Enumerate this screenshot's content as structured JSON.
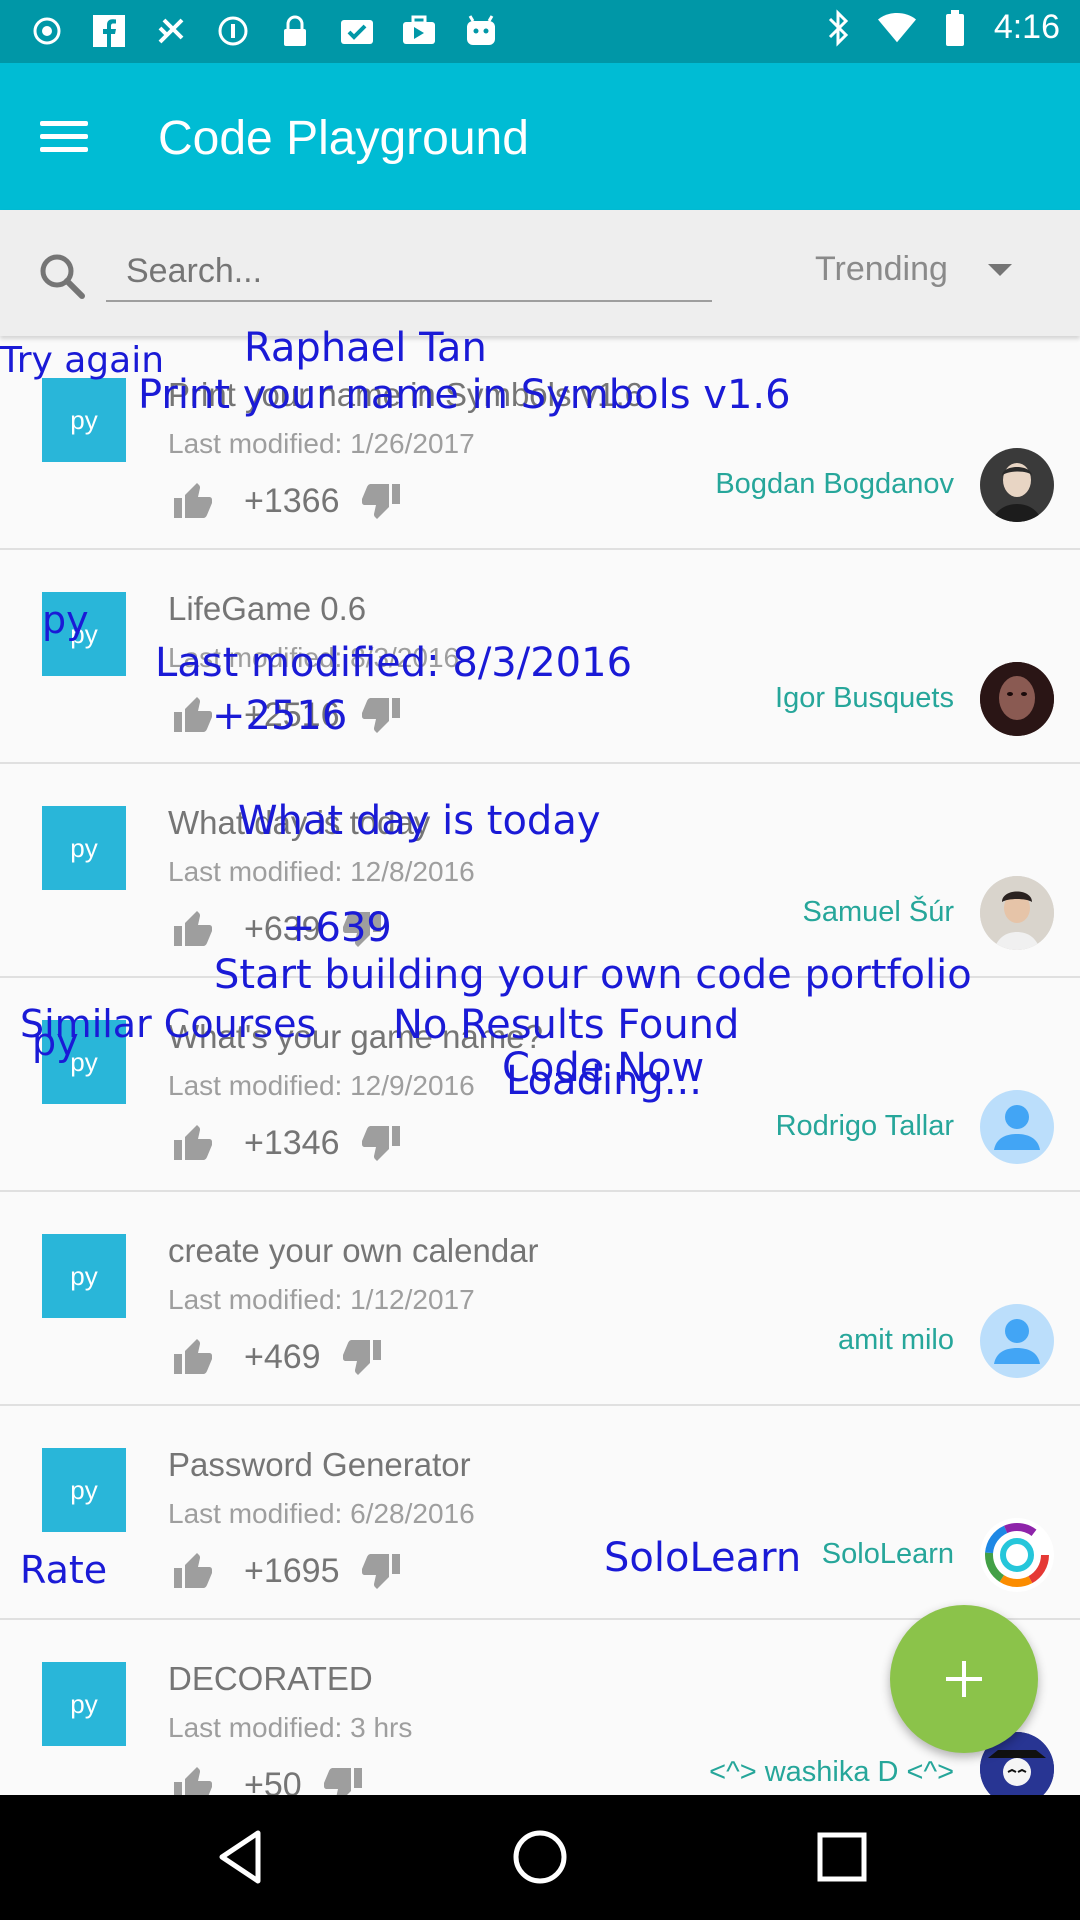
{
  "status_bar": {
    "time": "4:16",
    "left_icons": [
      "notification-dot-icon",
      "facebook-icon",
      "fake-gps-icon",
      "info-icon",
      "lock-icon",
      "checkbox-icon",
      "briefcase-icon",
      "play-store-icon",
      "android-icon"
    ],
    "right_icons": [
      "bluetooth-icon",
      "wifi-icon",
      "battery-icon"
    ]
  },
  "app_bar": {
    "title": "Code Playground",
    "menu_icon": "hamburger-menu-icon"
  },
  "search": {
    "placeholder": "Search...",
    "sort_selected": "Trending"
  },
  "rows": [
    {
      "lang": "py",
      "title": "Print your name in Symbols v1.6",
      "date": "Last modified: 1/26/2017",
      "votes": "+1366",
      "author": "Bogdan Bogdanov"
    },
    {
      "lang": "py",
      "title": "LifeGame 0.6",
      "date": "Last modified: 8/3/2016",
      "votes": "+2516",
      "author": "Igor Busquets"
    },
    {
      "lang": "py",
      "title": "What day is today",
      "date": "Last modified: 12/8/2016",
      "votes": "+639",
      "author": "Samuel Šúr"
    },
    {
      "lang": "py",
      "title": "What's your game name?",
      "date": "Last modified: 12/9/2016",
      "votes": "+1346",
      "author": "Rodrigo Tallar"
    },
    {
      "lang": "py",
      "title": "create your own calendar",
      "date": "Last modified: 1/12/2017",
      "votes": "+469",
      "author": "amit milo"
    },
    {
      "lang": "py",
      "title": "Password Generator",
      "date": "Last modified: 6/28/2016",
      "votes": "+1695",
      "author": "SoloLearn"
    },
    {
      "lang": "py",
      "title": "DECORATED",
      "date": "Last modified: 3 hrs",
      "votes": "+50",
      "author": "<^> washika D <^>"
    }
  ],
  "overlays": {
    "try_again": "Try again",
    "raphael": "Raphael Tan",
    "print_name": "Print your name in Symbols v1.6",
    "py_badge": "py",
    "last_modified": "Last modified: 8/3/2016",
    "votes": "+2516",
    "what_day": "What day is today",
    "votes2": "+639",
    "portfolio": "Start building your own code portfolio",
    "similar": "Similar Courses",
    "no_results": "No Results Found",
    "code_now": "Code Now",
    "loading": "Loading...",
    "py2": "py",
    "rate": "Rate",
    "sololearn": "SoloLearn"
  },
  "fab": {
    "icon": "plus-icon"
  },
  "nav": {
    "back": "back-icon",
    "home": "home-icon",
    "recents": "recents-icon"
  },
  "colors": {
    "primary": "#00bcd4",
    "primary_dark": "#0097a7",
    "badge": "#29b6d9",
    "author": "#26a69a",
    "fab": "#8bc34a",
    "overlay": "#1a1ad6"
  }
}
